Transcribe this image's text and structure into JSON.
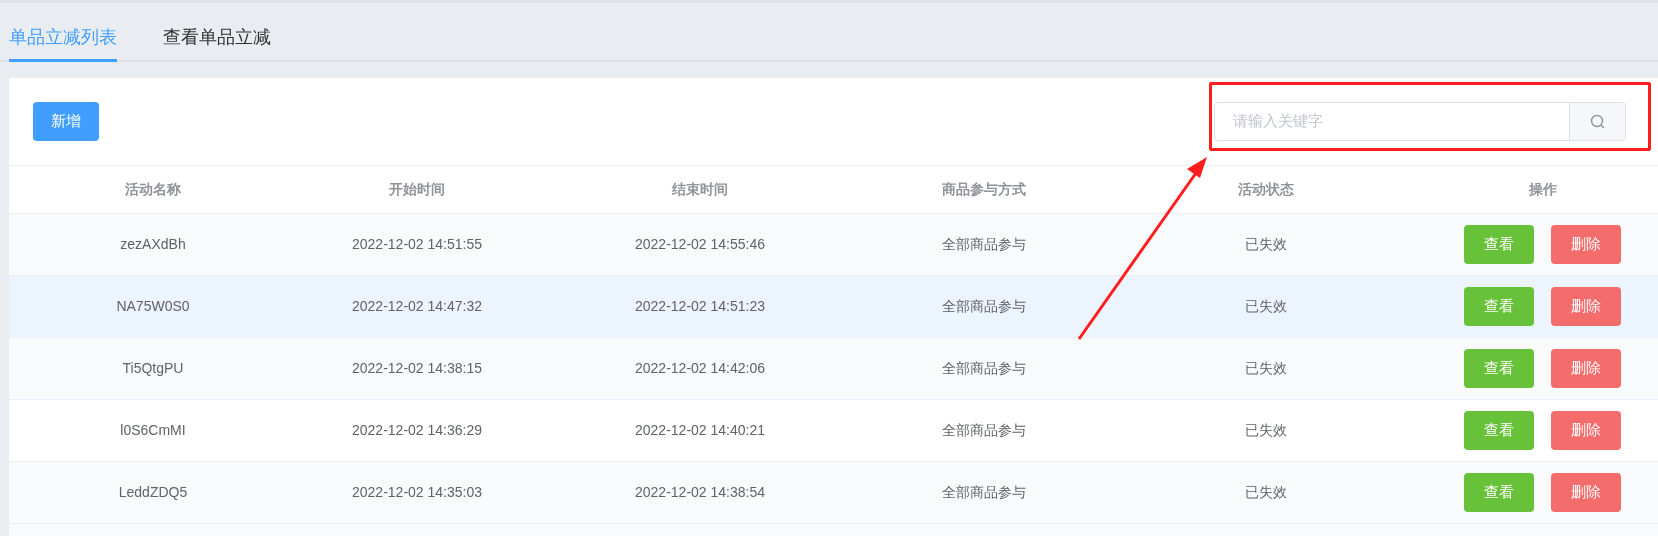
{
  "tabs": [
    {
      "label": "单品立减列表",
      "selected": true
    },
    {
      "label": "查看单品立减",
      "selected": false
    }
  ],
  "add_button": "新增",
  "search": {
    "placeholder": "请输入关键字"
  },
  "table": {
    "columns": [
      "活动名称",
      "开始时间",
      "结束时间",
      "商品参与方式",
      "活动状态",
      "操作"
    ],
    "rows": [
      {
        "name": "zezAXdBh",
        "start": "2022-12-02 14:51:55",
        "end": "2022-12-02 14:55:46",
        "mode": "全部商品参与",
        "status": "已失效",
        "actions": [
          "查看",
          "删除"
        ],
        "highlighted": false
      },
      {
        "name": "NA75W0S0",
        "start": "2022-12-02 14:47:32",
        "end": "2022-12-02 14:51:23",
        "mode": "全部商品参与",
        "status": "已失效",
        "actions": [
          "查看",
          "删除"
        ],
        "highlighted": true
      },
      {
        "name": "Ti5QtgPU",
        "start": "2022-12-02 14:38:15",
        "end": "2022-12-02 14:42:06",
        "mode": "全部商品参与",
        "status": "已失效",
        "actions": [
          "查看",
          "删除"
        ],
        "highlighted": false
      },
      {
        "name": "l0S6CmMI",
        "start": "2022-12-02 14:36:29",
        "end": "2022-12-02 14:40:21",
        "mode": "全部商品参与",
        "status": "已失效",
        "actions": [
          "查看",
          "删除"
        ],
        "highlighted": false
      },
      {
        "name": "LeddZDQ5",
        "start": "2022-12-02 14:35:03",
        "end": "2022-12-02 14:38:54",
        "mode": "全部商品参与",
        "status": "已失效",
        "actions": [
          "查看",
          "删除"
        ],
        "highlighted": false
      }
    ]
  }
}
